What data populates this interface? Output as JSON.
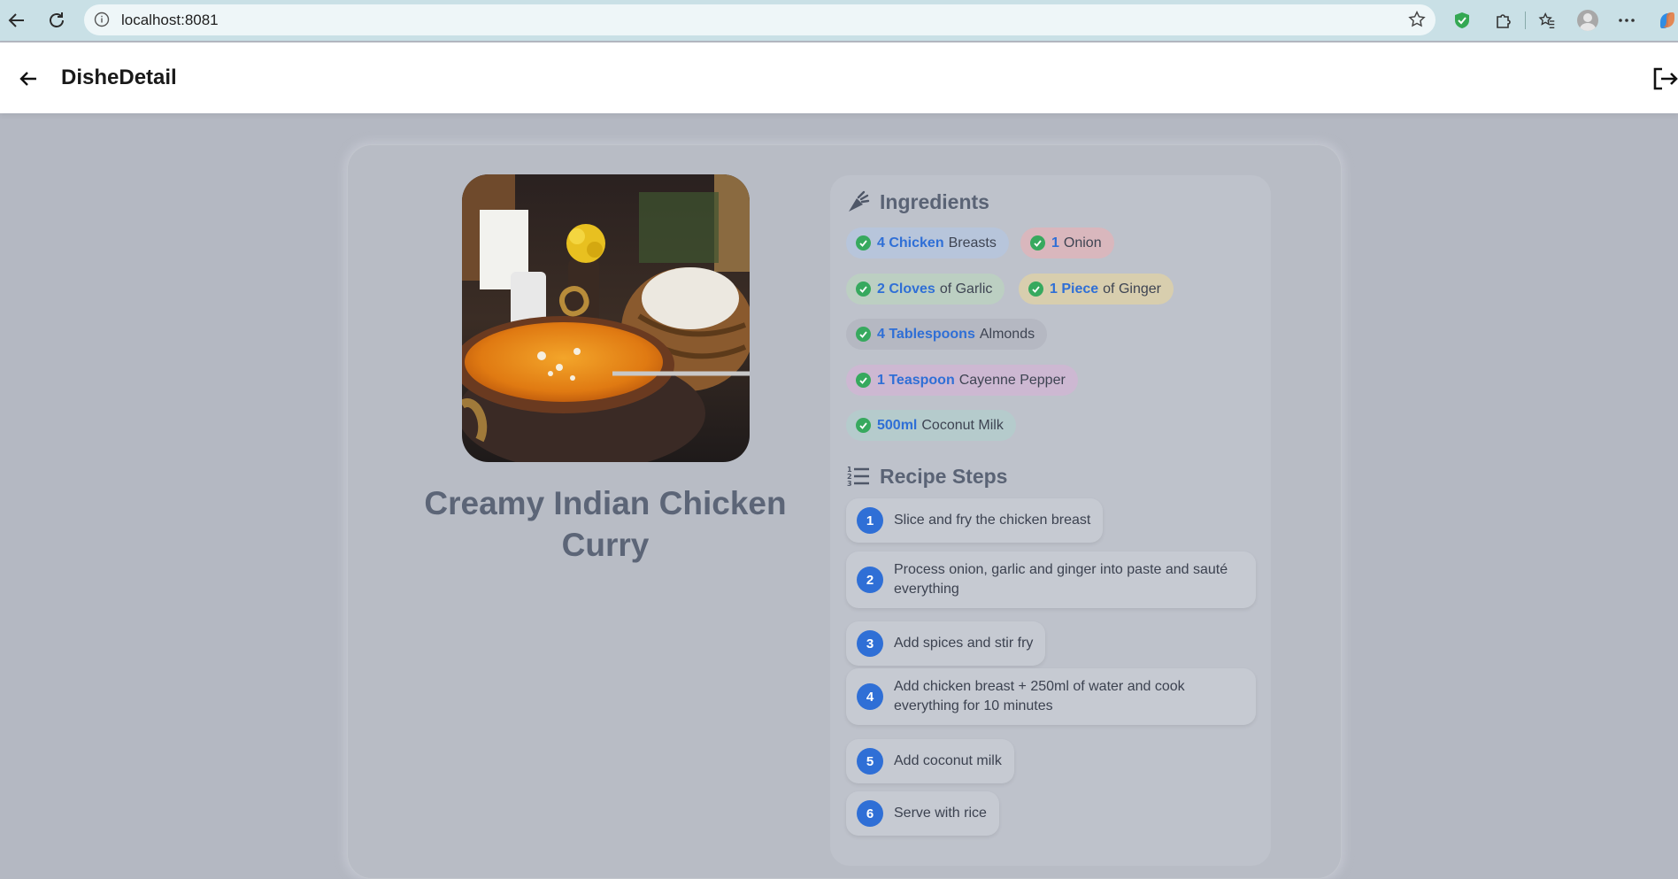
{
  "browser": {
    "url": "localhost:8081"
  },
  "header": {
    "title": "DisheDetail"
  },
  "dish": {
    "name": "Creamy Indian Chicken Curry"
  },
  "ingredients": {
    "heading": "Ingredients",
    "items": [
      {
        "qty": "4 Chicken",
        "name": "Breasts",
        "color": "#b7c5db"
      },
      {
        "qty": "1",
        "name": "Onion",
        "color": "#d9b7bd"
      },
      {
        "qty": "2 Cloves",
        "name": "of Garlic",
        "color": "#bccfc2"
      },
      {
        "qty": "1 Piece",
        "name": "of Ginger",
        "color": "#d8ceae"
      },
      {
        "qty": "4 Tablespoons",
        "name": "Almonds",
        "color": "#b5b8c2"
      },
      {
        "qty": "1 Teaspoon",
        "name": "Cayenne Pepper",
        "color": "#cdb8d2"
      },
      {
        "qty": "500ml",
        "name": "Coconut Milk",
        "color": "#b5cbcc"
      }
    ]
  },
  "steps": {
    "heading": "Recipe Steps",
    "items": [
      {
        "num": "1",
        "text": "Slice and fry the chicken breast"
      },
      {
        "num": "2",
        "text": "Process onion, garlic and ginger into paste and sauté everything"
      },
      {
        "num": "3",
        "text": "Add spices and stir fry"
      },
      {
        "num": "4",
        "text": "Add chicken breast + 250ml of water and cook everything for 10 minutes"
      },
      {
        "num": "5",
        "text": "Add coconut milk"
      },
      {
        "num": "6",
        "text": "Serve with rice"
      }
    ]
  },
  "colors": {
    "accent": "#2f6fd6",
    "check": "#37a95e",
    "title": "#5c6577"
  }
}
